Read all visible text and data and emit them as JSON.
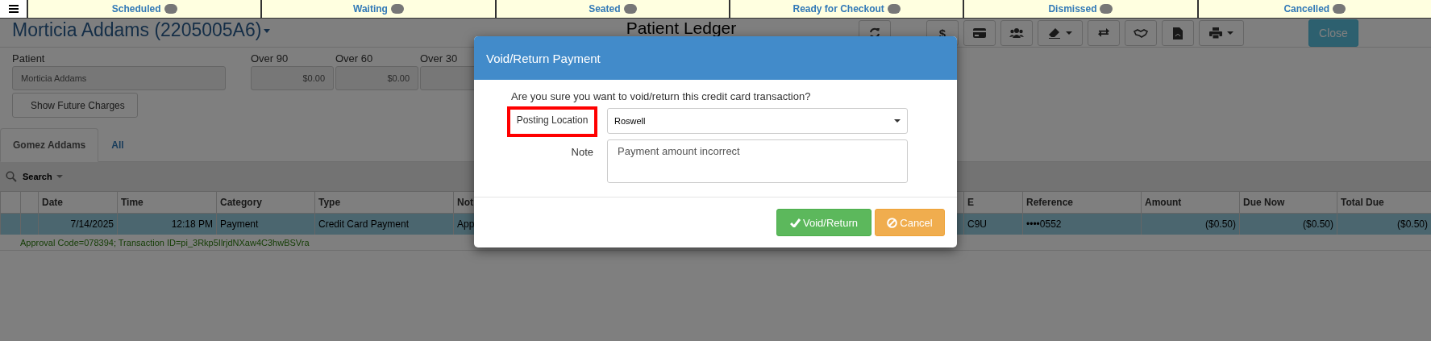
{
  "status_tabs": [
    {
      "label": "Scheduled"
    },
    {
      "label": "Waiting"
    },
    {
      "label": "Seated"
    },
    {
      "label": "Ready for Checkout"
    },
    {
      "label": "Dismissed"
    },
    {
      "label": "Cancelled"
    }
  ],
  "header": {
    "patient_title": "Morticia Addams (2205005A6)",
    "page_title": "Patient Ledger",
    "dollar_button": "$",
    "close_button": "Close"
  },
  "patient": {
    "label": "Patient",
    "value": "Morticia Addams",
    "future_charges_button": "Show Future Charges"
  },
  "aging": [
    {
      "label": "Over 90",
      "value": "$0.00"
    },
    {
      "label": "Over 60",
      "value": "$0.00"
    },
    {
      "label": "Over 30"
    }
  ],
  "account_tabs": [
    {
      "label": "Gomez Addams",
      "selected": true
    },
    {
      "label": "All",
      "selected": false
    }
  ],
  "search": {
    "label": "Search"
  },
  "table": {
    "columns_left": [
      "Date",
      "Time",
      "Category",
      "Type",
      "Not"
    ],
    "columns_right": [
      "E",
      "Reference",
      "Amount",
      "Due Now",
      "Total Due"
    ],
    "rows": [
      {
        "selected": true,
        "left": [
          "7/14/2025",
          "12:18 PM",
          "Payment",
          "Credit Card Payment",
          "App"
        ],
        "right": [
          "C9U",
          "••••0552",
          "($0.50)",
          "($0.50)",
          "($0.50)"
        ],
        "detail": "Approval Code=078394; Transaction ID=pi_3Rkp5IlrjdNXaw4C3hwBSVra"
      }
    ]
  },
  "dialog": {
    "title": "Void/Return Payment",
    "question": "Are you sure you want to void/return this credit card transaction?",
    "location_label": "Posting Location",
    "location_value": "Roswell",
    "note_label": "Note",
    "note_value": "Payment amount incorrect",
    "confirm_button": "Void/Return",
    "cancel_button": "Cancel"
  }
}
